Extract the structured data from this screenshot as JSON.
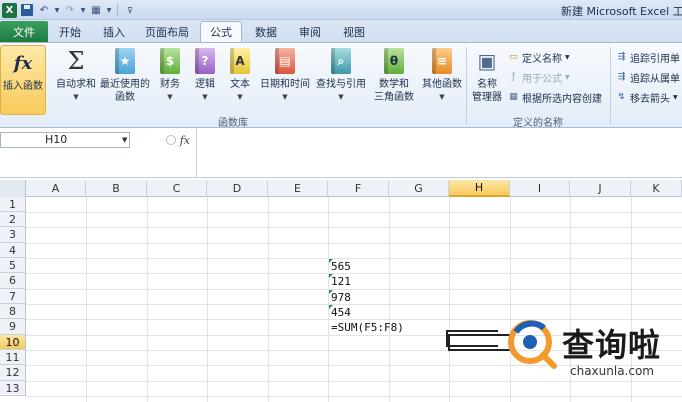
{
  "window": {
    "title": "新建 Microsoft Excel 工作表"
  },
  "qat": {
    "icons": [
      "excel-logo",
      "save-icon",
      "undo-icon",
      "redo-icon",
      "table-icon",
      "customize-icon"
    ],
    "logo_letter": "X"
  },
  "tabs": [
    {
      "label": "文件",
      "active": false
    },
    {
      "label": "开始",
      "active": false
    },
    {
      "label": "插入",
      "active": false
    },
    {
      "label": "页面布局",
      "active": false
    },
    {
      "label": "公式",
      "active": true
    },
    {
      "label": "数据",
      "active": false
    },
    {
      "label": "审阅",
      "active": false
    },
    {
      "label": "视图",
      "active": false
    }
  ],
  "ribbon": {
    "insert_function": {
      "label": "插入函数",
      "icon": "fx"
    },
    "autosum": {
      "label": "自动求和",
      "icon": "Σ"
    },
    "recent": {
      "label1": "最近使用的",
      "label2": "函数"
    },
    "financial": {
      "label": "财务"
    },
    "logical": {
      "label": "逻辑",
      "glyph": "?"
    },
    "text": {
      "label": "文本",
      "glyph": "A"
    },
    "datetime": {
      "label": "日期和时间"
    },
    "lookup": {
      "label": "查找与引用"
    },
    "math": {
      "label1": "数学和",
      "label2": "三角函数",
      "glyph": "θ"
    },
    "more": {
      "label": "其他函数"
    },
    "group_library": "函数库",
    "name_manager": {
      "label1": "名称",
      "label2": "管理器"
    },
    "define_name": "定义名称",
    "use_in_formula": "用于公式",
    "create_from_selection": "根据所选内容创建",
    "group_names": "定义的名称",
    "trace_precedents": "追踪引用单",
    "trace_dependents": "追踪从属单",
    "remove_arrows": "移去箭头"
  },
  "formula_bar": {
    "name_box": "H10",
    "fx": "fx",
    "formula": ""
  },
  "columns": [
    "A",
    "B",
    "C",
    "D",
    "E",
    "F",
    "G",
    "H",
    "I",
    "J",
    "K"
  ],
  "rows": [
    "1",
    "2",
    "3",
    "4",
    "5",
    "6",
    "7",
    "8",
    "9",
    "10",
    "11",
    "12",
    "13"
  ],
  "selected": {
    "column": "H",
    "row": "10"
  },
  "cells": {
    "F5": "565",
    "F6": "121",
    "F7": "978",
    "F8": "454",
    "F9": "=SUM(F5:F8)"
  },
  "watermark": {
    "text": "查询啦",
    "url": "chaxunla.com"
  },
  "colors": {
    "accent_green": "#1f7a40",
    "selection": "#f7c95d",
    "watermark_orange": "#f39a2b",
    "watermark_blue": "#1f5fb4"
  }
}
